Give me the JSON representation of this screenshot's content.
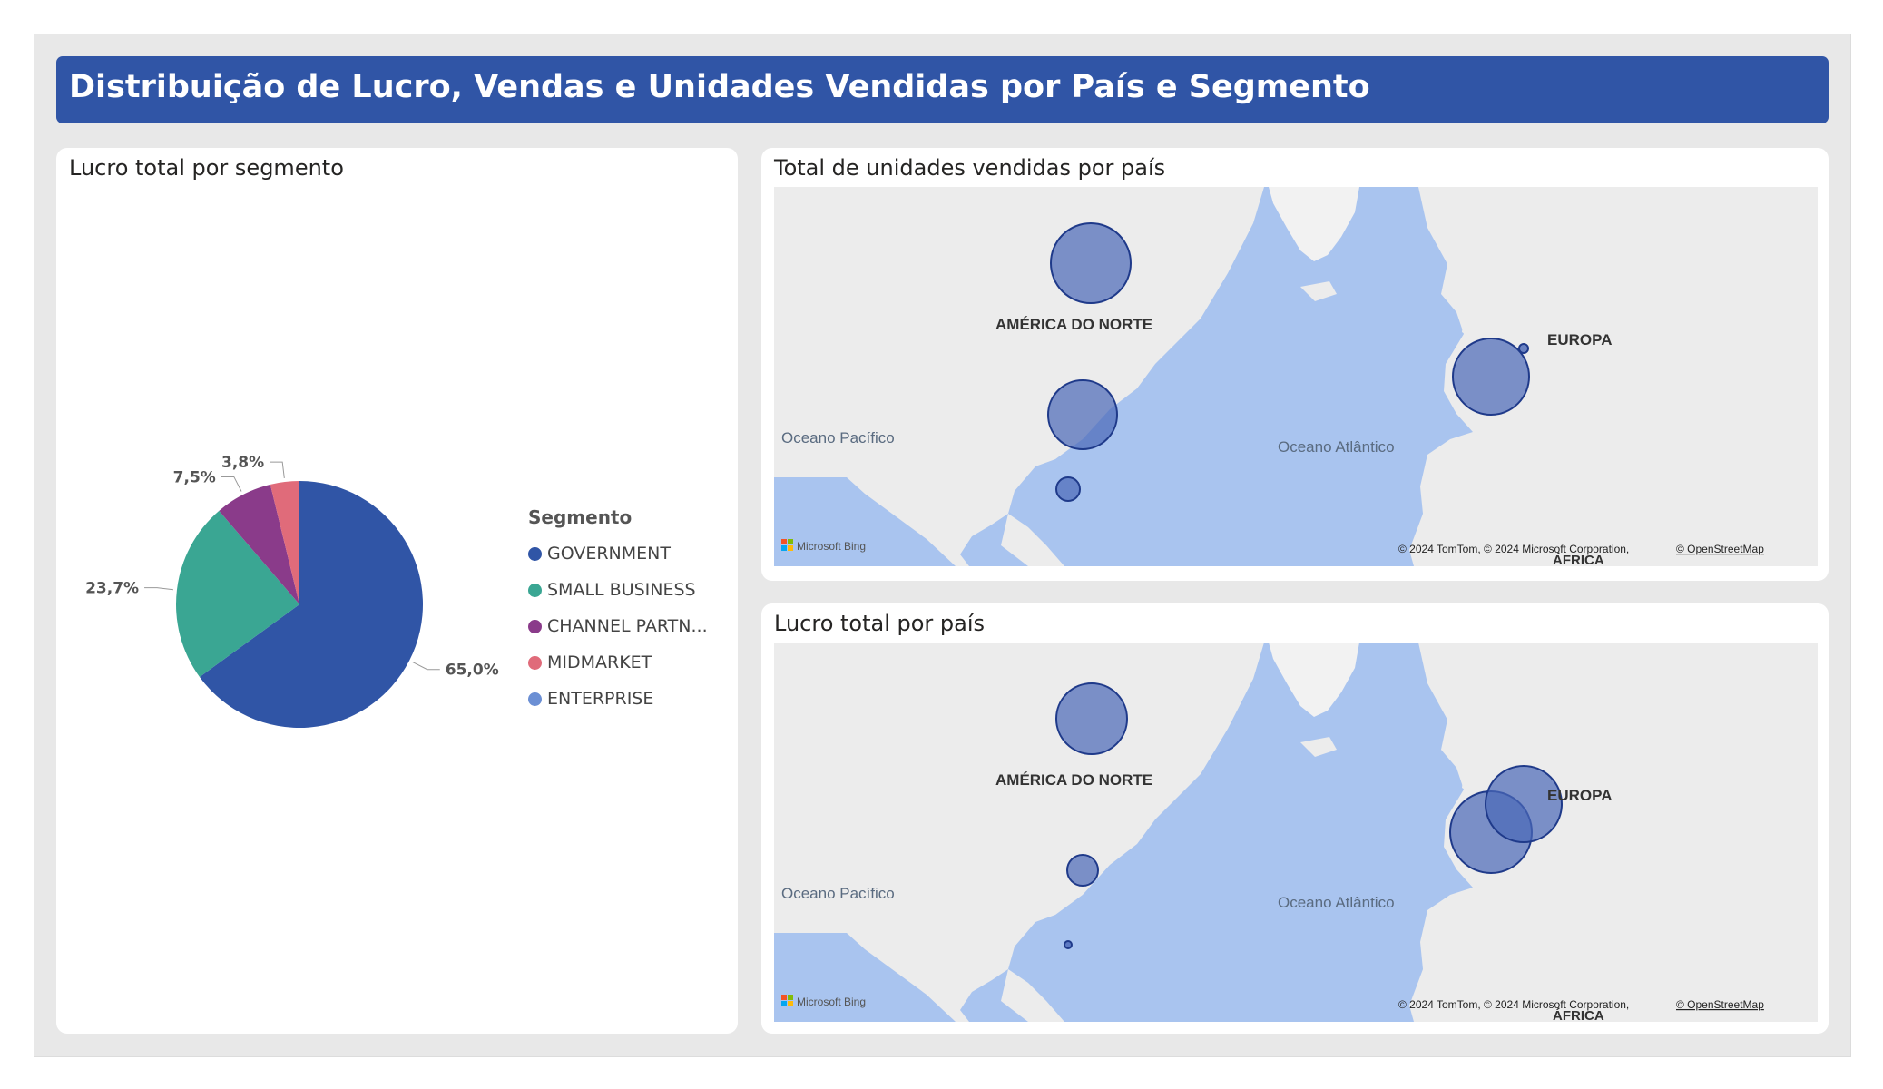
{
  "header": {
    "title": "Distribuição de Lucro, Vendas e Unidades Vendidas por País e Segmento"
  },
  "pie_card": {
    "title": "Lucro total por segmento",
    "legend_title": "Segmento"
  },
  "units_map": {
    "title": "Total de unidades vendidas por país",
    "labels": {
      "north_america": "AMÉRICA DO NORTE",
      "europe": "EUROPA",
      "pacific": "Oceano Pacífico",
      "atlantic": "Oceano Atlântico",
      "africa": "ÁFRICA"
    },
    "bing": "Microsoft Bing",
    "copyright": "© 2024 TomTom, © 2024 Microsoft Corporation, ",
    "osm": "© OpenStreetMap"
  },
  "profit_map": {
    "title": "Lucro total por país",
    "labels": {
      "north_america": "AMÉRICA DO NORTE",
      "europe": "EUROPA",
      "pacific": "Oceano Pacífico",
      "atlantic": "Oceano Atlântico",
      "africa": "ÁFRICA"
    },
    "bing": "Microsoft Bing",
    "copyright": "© 2024 TomTom, © 2024 Microsoft Corporation, ",
    "osm": "© OpenStreetMap"
  },
  "colors": {
    "accent": "#3055a6",
    "bubble": "#4a68b8"
  },
  "chart_data": [
    {
      "type": "pie",
      "title": "Lucro total por segmento",
      "legend_title": "Segmento",
      "legend_position": "right",
      "categories": [
        "GOVERNMENT",
        "SMALL BUSINESS",
        "CHANNEL PARTN...",
        "MIDMARKET",
        "ENTERPRISE"
      ],
      "values": [
        65.0,
        23.7,
        7.5,
        3.8,
        0.0
      ],
      "data_labels": [
        "65,0%",
        "23,7%",
        "7,5%",
        "3,8%",
        ""
      ],
      "colors": [
        "#3055a6",
        "#3aa693",
        "#8a3b8a",
        "#e06b7a",
        "#6b8fd4"
      ]
    }
  ]
}
